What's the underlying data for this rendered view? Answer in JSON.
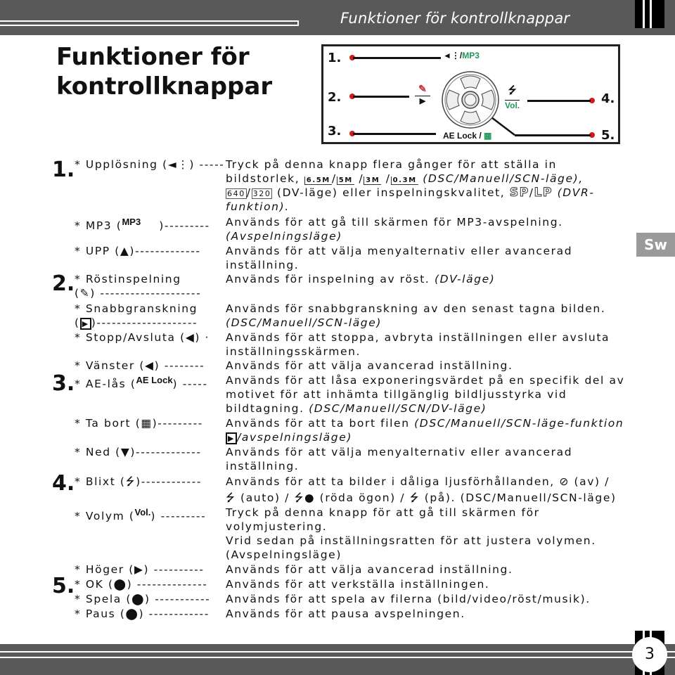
{
  "header": {
    "title": "Funktioner för kontrollknappar"
  },
  "page_title_line1": "Funktioner för",
  "page_title_line2": "kontrollknappar",
  "diagram": {
    "numbers": [
      "1.",
      "2.",
      "3.",
      "4.",
      "5."
    ],
    "label_top_sep": "/",
    "label_top_mp3": "MP3",
    "label_right_vol": "Vol.",
    "label_bottom_ae": "AE Lock",
    "label_bottom_sep": "/",
    "colors": {
      "green": "#1f9a5a",
      "red_dot": "#d21a1a",
      "mic": "#c8323c"
    }
  },
  "language_tab": "Sw",
  "sections": [
    {
      "number": "1.",
      "items": [
        {
          "label_pre": "* Upplösning (",
          "label_post": ") -----",
          "lines": [
            "Tryck på denna knapp flera gånger för att ställa in",
            "bildstorlek, ",
            " (DV-läge) eller inspelningskvalitet, ",
            "funktion)."
          ],
          "sizes": [
            "6.5M",
            "5M",
            "3M",
            "0.3M"
          ],
          "video_sizes": [
            "640",
            "320"
          ],
          "mode_dsc": "(DSC/Manuell/SCN-läge),",
          "quality": [
            "SP",
            "LP"
          ],
          "mode_dvr": "(DVR-"
        },
        {
          "label_pre": "* MP3 (",
          "icon_text": "MP3",
          "label_post": ")---------",
          "lines": [
            "Används för att gå till skärmen för MP3-avspelning.",
            "(Avspelningsläge)"
          ]
        },
        {
          "label_pre": "* UPP (",
          "label_post": ")-------------",
          "lines": [
            "Används för att välja menyalternativ eller avancerad",
            "inställning."
          ]
        }
      ]
    },
    {
      "number": "2.",
      "items": [
        {
          "label_line1": "* Röstinspelning",
          "label_pre": "(",
          "label_post": ") --------------------",
          "lines": [
            "Används för inspelning av röst. ",
            "(DV-läge)"
          ]
        },
        {
          "label_line1": "* Snabbgranskning",
          "label_pre": "(",
          "label_post": ")--------------------",
          "lines": [
            "Används för snabbgranskning av den senast tagna bilden.",
            "(DSC/Manuell/SCN-läge)"
          ]
        },
        {
          "label_pre": "* Stopp/Avsluta (",
          "label_post": ") ·",
          "lines": [
            "Används för att stoppa, avbryta inställningen eller avsluta",
            "inställningsskärmen."
          ]
        }
      ]
    },
    {
      "number": "3.",
      "items": [
        {
          "label_pre": "* Vänster (",
          "label_post": ") --------",
          "lines": [
            "Används för att välja avancerad inställning."
          ]
        },
        {
          "label_pre": "* AE-lås (",
          "icon_text": "AE Lock",
          "label_post": ") -----",
          "lines": [
            "Används för att låsa exponeringsvärdet på en specifik del av",
            "motivet för att inhämta tillgänglig bildljusstyrka vid",
            "bildtagning. ",
            "(DSC/Manuell/SCN/DV-läge)"
          ]
        },
        {
          "label_pre": "* Ta bort (",
          "label_post": ")---------",
          "lines": [
            "Används för att ta bort filen ",
            "(DSC/Manuell/SCN-läge-funktion",
            "/avspelningsläge)"
          ]
        },
        {
          "label_pre": "* Ned (",
          "label_post": ")-------------",
          "lines": [
            "Används för att välja menyalternativ eller avancerad",
            "inställning."
          ]
        }
      ]
    },
    {
      "number": "4.",
      "items": [
        {
          "label_pre": "* Blixt (",
          "label_post": ")------------",
          "lines": [
            "Används för att ta bilder i dåliga ljusförhållanden, ",
            " (av) /",
            " (auto) / ",
            " (röda ögon) / ",
            " (på). (DSC/Manuell/SCN-läge)"
          ]
        },
        {
          "label_pre": "* Volym (",
          "icon_text": "Vol.",
          "label_post": ") ---------",
          "lines": [
            "Tryck på denna knapp för att gå till skärmen för",
            "volymjustering.",
            "Vrid sedan på inställningsratten för att justera volymen.",
            "(Avspelningsläge)"
          ]
        }
      ]
    },
    {
      "number": "5.",
      "items": [
        {
          "label_pre": "* Höger (",
          "label_post": ") ----------",
          "lines": [
            "Används för att välja avancerad inställning."
          ]
        },
        {
          "label_pre": "* OK (",
          "label_post": ") --------------",
          "lines": [
            "Används för att verkställa inställningen."
          ]
        },
        {
          "label_pre": "* Spela (",
          "label_post": ") -----------",
          "lines": [
            "Används för att spela av filerna (bild/video/röst/musik)."
          ]
        },
        {
          "label_pre": "* Paus (",
          "label_post": ") ------------",
          "lines": [
            "Används för att pausa avspelningen."
          ]
        }
      ]
    }
  ],
  "footer": {
    "page_number": "3"
  }
}
